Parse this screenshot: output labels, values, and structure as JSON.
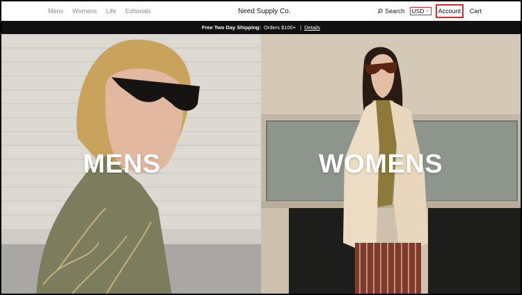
{
  "nav": {
    "left_links": [
      "Mens",
      "Womens",
      "Life",
      "Editorials"
    ],
    "brand": "Need Supply Co.",
    "search_label": "Search",
    "currency": "USD",
    "account_label": "Account",
    "cart_label": "Cart"
  },
  "promo": {
    "bold_text": "Free Two Day Shipping:",
    "text": "Orders $100+",
    "separator": "|",
    "link": "Details"
  },
  "hero": {
    "mens_title": "MENS",
    "womens_title": "WOMENS"
  },
  "colors": {
    "highlight_red": "#d6262b",
    "promo_bg": "#101010"
  }
}
